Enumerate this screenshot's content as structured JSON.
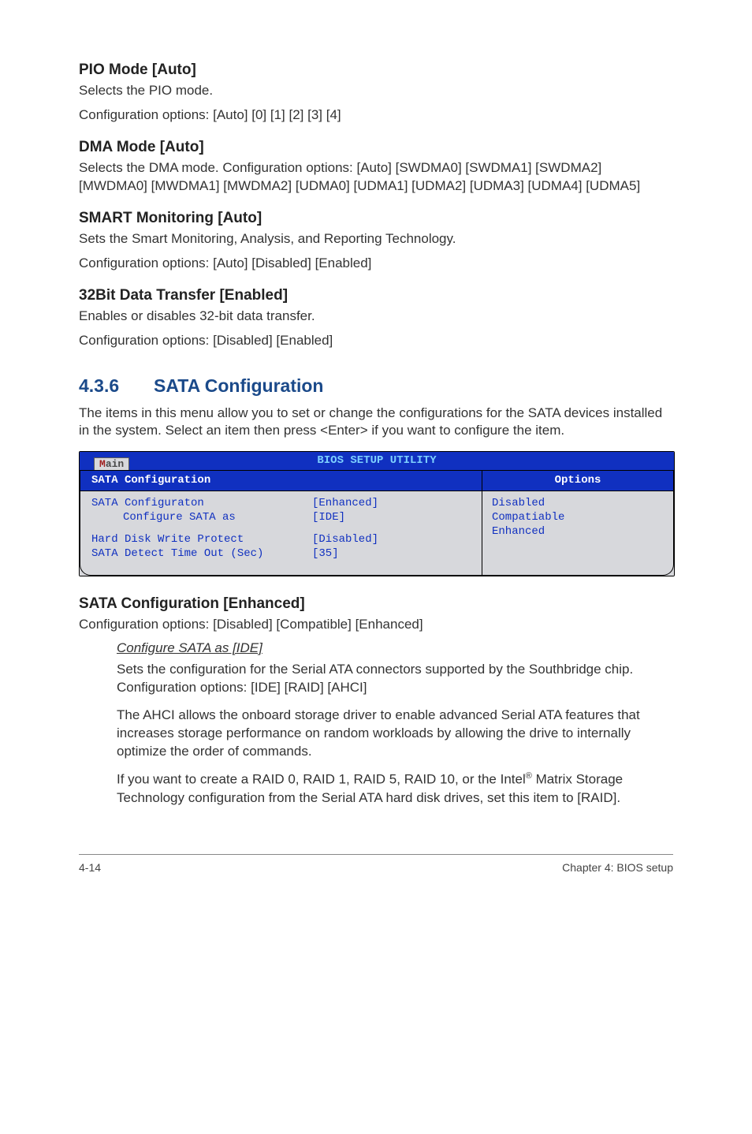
{
  "sections": {
    "pio": {
      "heading": "PIO Mode [Auto]",
      "line1": "Selects the PIO mode.",
      "line2": "Configuration options: [Auto] [0] [1] [2] [3] [4]"
    },
    "dma": {
      "heading": "DMA Mode [Auto]",
      "line1": "Selects the DMA mode. Configuration options: [Auto] [SWDMA0] [SWDMA1] [SWDMA2] [MWDMA0] [MWDMA1] [MWDMA2] [UDMA0] [UDMA1] [UDMA2] [UDMA3] [UDMA4] [UDMA5]"
    },
    "smart": {
      "heading": "SMART Monitoring [Auto]",
      "line1": "Sets the Smart Monitoring, Analysis, and Reporting Technology.",
      "line2": "Configuration options: [Auto] [Disabled] [Enabled]"
    },
    "transfer": {
      "heading": "32Bit Data Transfer [Enabled]",
      "line1": "Enables or disables 32-bit data transfer.",
      "line2": "Configuration options: [Disabled] [Enabled]"
    }
  },
  "section_436": {
    "number": "4.3.6",
    "title": "SATA Configuration",
    "intro": "The items in this menu allow you to set or change the configurations for the SATA devices installed in the system. Select an item then press <Enter> if you want to configure the item."
  },
  "bios": {
    "title": "BIOS SETUP UTILITY",
    "tab_first": "M",
    "tab_rest": "ain",
    "left_header": "SATA Configuration",
    "rows": [
      {
        "label": "SATA Configuraton",
        "val": "[Enhanced]",
        "indent": false
      },
      {
        "label": "Configure SATA as",
        "val": "[IDE]",
        "indent": true
      }
    ],
    "rows2": [
      {
        "label": "Hard Disk Write Protect",
        "val": "[Disabled]",
        "indent": false
      },
      {
        "label": "SATA Detect Time Out (Sec)",
        "val": "[35]",
        "indent": false
      }
    ],
    "right_header": "Options",
    "options": [
      "Disabled",
      "Compatiable",
      "Enhanced"
    ]
  },
  "sata_conf": {
    "heading": "SATA Configuration [Enhanced]",
    "line1": "Configuration options: [Disabled] [Compatible] [Enhanced]",
    "sub_heading": "Configure SATA as [IDE]",
    "p1": "Sets the configuration for the Serial ATA connectors supported by the Southbridge chip. Configuration options: [IDE] [RAID] [AHCI]",
    "p2": "The AHCI allows the onboard storage driver to enable advanced Serial ATA features that increases storage performance on random workloads by allowing the drive to internally optimize the order of commands.",
    "p3a": "If you want to create a RAID 0, RAID 1, RAID 5, RAID 10, or the Intel",
    "p3sup": "®",
    "p3b": " Matrix Storage Technology configuration from the Serial ATA hard disk drives, set this item to [RAID]."
  },
  "footer": {
    "left": "4-14",
    "right": "Chapter 4: BIOS setup"
  }
}
